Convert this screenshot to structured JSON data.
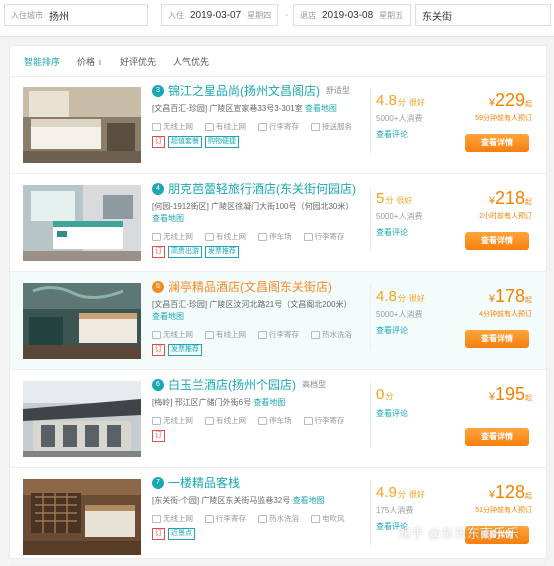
{
  "search": {
    "dest_label": "入住城市",
    "dest_value": "扬州",
    "checkin_label": "入住",
    "checkin_date": "2019-03-07",
    "checkin_week": "星期四",
    "checkout_label": "退店",
    "checkout_date": "2019-03-08",
    "checkout_week": "星期五",
    "dash": "-",
    "keyword": "东关街"
  },
  "sort": {
    "items": [
      "智能排序",
      "价格",
      "好评优先",
      "人气优先"
    ],
    "active": 0
  },
  "hotels": [
    {
      "index": "3",
      "name": "锦江之星品尚(扬州文昌阁店)",
      "type": "舒适型",
      "address": "[文昌百汇-珍园] 广陵区宣家巷33号3-301室",
      "map_link": "查看地图",
      "facilities": [
        "无线上网",
        "有线上网",
        "行李寄存",
        "接送服务"
      ],
      "tags": [
        "订",
        "超值套餐",
        "购物便捷"
      ],
      "score": "4.8",
      "score_unit": "分",
      "score_word": "很好",
      "reviews": "5000+人消费",
      "see_comments": "查看评论",
      "currency": "¥",
      "price": "229",
      "price_suffix": "起",
      "recent": "59分钟前有人预订",
      "button": "查看详情"
    },
    {
      "index": "4",
      "name": "朋克芭蕾轻旅行酒店(东关街何园店)",
      "type": "",
      "address": "[何园-1912街区] 广陵区徐凝门大街100号（何园北30米）",
      "map_link": "查看地图",
      "facilities": [
        "无线上网",
        "有线上网",
        "停车场",
        "行李寄存"
      ],
      "tags": [
        "订",
        "高贵出游",
        "发票推荐"
      ],
      "score": "5",
      "score_unit": "分",
      "score_word": "很好",
      "reviews": "5000+人消费",
      "see_comments": "查看评论",
      "currency": "¥",
      "price": "218",
      "price_suffix": "起",
      "recent": "2小时前有人预订",
      "button": "查看详情"
    },
    {
      "index": "5",
      "name": "澜亭精品酒店(文昌阁东关街店)",
      "type": "",
      "address": "[文昌百汇-珍园] 广陵区汶河北路21号（文昌阁北200米）",
      "map_link": "查看地图",
      "facilities": [
        "无线上网",
        "有线上网",
        "行李寄存",
        "热水洗浴"
      ],
      "tags": [
        "订",
        "发票推荐"
      ],
      "score": "4.8",
      "score_unit": "分",
      "score_word": "很好",
      "reviews": "5000+人消费",
      "see_comments": "查看评论",
      "currency": "¥",
      "price": "178",
      "price_suffix": "起",
      "recent": "4分钟前有人预订",
      "button": "查看详情"
    },
    {
      "index": "6",
      "name": "白玉兰酒店(扬州个园店)",
      "type": "高档型",
      "address": "[梅岭] 邗江区广储门外街6号",
      "map_link": "查看地图",
      "facilities": [
        "无线上网",
        "有线上网",
        "停车场",
        "行李寄存"
      ],
      "tags": [
        "订"
      ],
      "score": "0",
      "score_unit": "分",
      "score_word": "",
      "reviews": "",
      "see_comments": "查看评论",
      "currency": "¥",
      "price": "195",
      "price_suffix": "起",
      "recent": "",
      "button": "查看详情"
    },
    {
      "index": "7",
      "name": "一楼精品客栈",
      "type": "",
      "address": "[东关街-个园] 广陵区东关街马监巷32号",
      "map_link": "查看地图",
      "facilities": [
        "无线上网",
        "行李寄存",
        "热水洗浴",
        "电吹风"
      ],
      "tags": [
        "订",
        "近景点"
      ],
      "score": "4.9",
      "score_unit": "分",
      "score_word": "很好",
      "reviews": "175人消费",
      "see_comments": "查看评论",
      "currency": "¥",
      "price": "128",
      "price_suffix": "起",
      "recent": "51分钟前有人预订",
      "button": "查看详情"
    }
  ],
  "watermark": "知乎 @东东东南乐乐"
}
